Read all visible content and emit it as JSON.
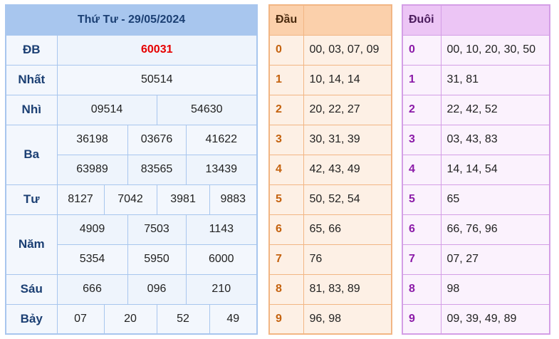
{
  "results": {
    "title": "Thứ Tư - 29/05/2024",
    "rows": [
      {
        "label": "ĐB",
        "values": [
          "60031"
        ]
      },
      {
        "label": "Nhất",
        "values": [
          "50514"
        ]
      },
      {
        "label": "Nhì",
        "values": [
          "09514",
          "54630"
        ]
      },
      {
        "label": "Ba",
        "values": [
          "36198",
          "03676",
          "41622",
          "63989",
          "83565",
          "13439"
        ]
      },
      {
        "label": "Tư",
        "values": [
          "8127",
          "7042",
          "3981",
          "9883"
        ]
      },
      {
        "label": "Năm",
        "values": [
          "4909",
          "7503",
          "1143",
          "5354",
          "5950",
          "6000"
        ]
      },
      {
        "label": "Sáu",
        "values": [
          "666",
          "096",
          "210"
        ]
      },
      {
        "label": "Bảy",
        "values": [
          "07",
          "20",
          "52",
          "49"
        ]
      }
    ]
  },
  "dau": {
    "header": "Đầu",
    "rows": [
      {
        "key": "0",
        "values": "00, 03, 07, 09"
      },
      {
        "key": "1",
        "values": "10, 14, 14"
      },
      {
        "key": "2",
        "values": "20, 22, 27"
      },
      {
        "key": "3",
        "values": "30, 31, 39"
      },
      {
        "key": "4",
        "values": "42, 43, 49"
      },
      {
        "key": "5",
        "values": "50, 52, 54"
      },
      {
        "key": "6",
        "values": "65, 66"
      },
      {
        "key": "7",
        "values": "76"
      },
      {
        "key": "8",
        "values": "81, 83, 89"
      },
      {
        "key": "9",
        "values": "96, 98"
      }
    ]
  },
  "duoi": {
    "header": "Đuôi",
    "rows": [
      {
        "key": "0",
        "values": "00, 10, 20, 30, 50"
      },
      {
        "key": "1",
        "values": "31, 81"
      },
      {
        "key": "2",
        "values": "22, 42, 52"
      },
      {
        "key": "3",
        "values": "03, 43, 83"
      },
      {
        "key": "4",
        "values": "14, 14, 54"
      },
      {
        "key": "5",
        "values": "65"
      },
      {
        "key": "6",
        "values": "66, 76, 96"
      },
      {
        "key": "7",
        "values": "07, 27"
      },
      {
        "key": "8",
        "values": "98"
      },
      {
        "key": "9",
        "values": "09, 39, 49, 89"
      }
    ]
  },
  "colors": {
    "result_accent": "#a8c6ee",
    "special_prize": "#e60000",
    "dau_accent": "#f2b684",
    "duoi_accent": "#d49ee6"
  }
}
